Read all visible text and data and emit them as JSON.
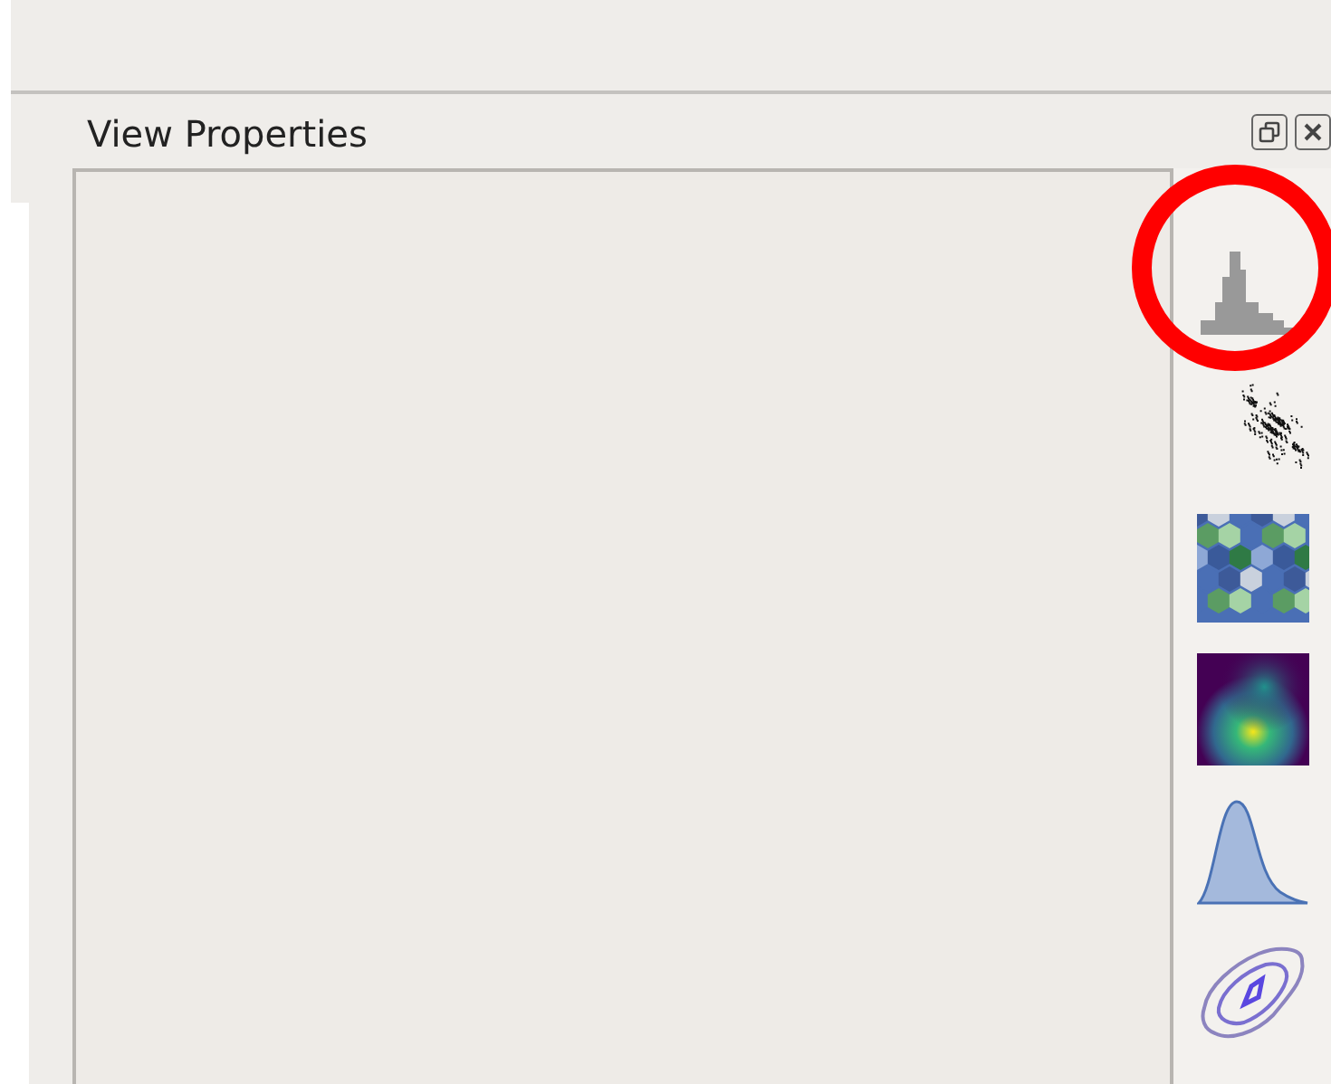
{
  "panel": {
    "title": "View Properties"
  },
  "tools": [
    {
      "kind": "histogram",
      "highlighted": true
    },
    {
      "kind": "scatter",
      "highlighted": false
    },
    {
      "kind": "hexbin",
      "highlighted": false
    },
    {
      "kind": "heatmap",
      "highlighted": false
    },
    {
      "kind": "density",
      "highlighted": false
    },
    {
      "kind": "contour",
      "highlighted": false
    }
  ]
}
